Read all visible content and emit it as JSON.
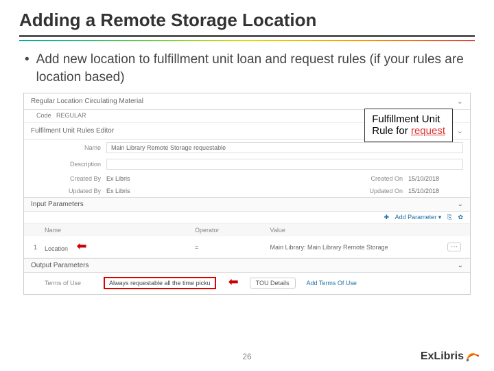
{
  "title": "Adding a Remote Storage Location",
  "bullet": "Add new location to fulfillment unit loan and request rules (if your rules are location based)",
  "callout": {
    "line1": "Fulfillment Unit",
    "line2a": "Rule for ",
    "line2b": "request"
  },
  "shot": {
    "section1": "Regular Location Circulating Material",
    "code_label": "Code",
    "code_value": "REGULAR",
    "section2": "Fulfilment Unit Rules Editor",
    "name_label": "Name",
    "name_value": "Main Library Remote Storage requestable",
    "desc_label": "Description",
    "createdby_label": "Created By",
    "createdby_value": "Ex Libris",
    "createdon_label": "Created On",
    "createdon_value": "15/10/2018",
    "updatedby_label": "Updated By",
    "updatedby_value": "Ex Libris",
    "updatedon_label": "Updated On",
    "updatedon_value": "15/10/2018",
    "input_params": "Input Parameters",
    "add_param": "Add Parameter",
    "col_name": "Name",
    "col_operator": "Operator",
    "col_value": "Value",
    "row_idx": "1",
    "row_name": "Location",
    "row_op": "=",
    "row_value": "Main Library: Main Library Remote Storage",
    "output_params": "Output Parameters",
    "tou_label": "Terms of Use",
    "tou_value": "Always requestable all the time picku",
    "tou_btn": "TOU Details",
    "add_tou": "Add Terms Of Use"
  },
  "pagenum": "26",
  "logo": "ExLibris"
}
